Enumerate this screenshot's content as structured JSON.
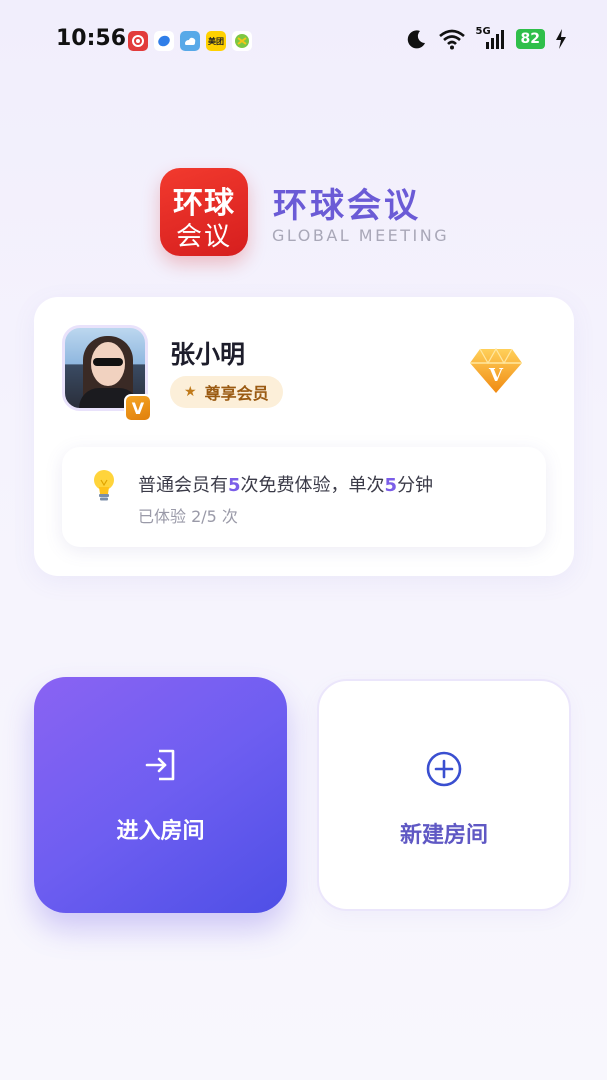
{
  "status_bar": {
    "time": "10:56",
    "network": "5G",
    "battery": "82",
    "apps": [
      {
        "name": "app-icon-1",
        "color": "#e23b3b",
        "text": ""
      },
      {
        "name": "app-icon-2",
        "color": "#2f7ee8",
        "text": ""
      },
      {
        "name": "app-icon-3",
        "color": "#58a9e8",
        "text": ""
      },
      {
        "name": "meituan-icon",
        "color": "#ffd100",
        "text": "美团"
      },
      {
        "name": "app-icon-5",
        "color": "#7cc743",
        "text": ""
      }
    ]
  },
  "brand": {
    "logo_line1": "环球",
    "logo_line2": "会议",
    "name": "环球会议",
    "subtitle": "GLOBAL MEETING",
    "logo_color": "#e5271f",
    "name_color": "#6b5bd6"
  },
  "profile": {
    "name": "张小明",
    "avatar_badge": "V",
    "member_level": "尊享会员",
    "diamond_letter": "V"
  },
  "tip": {
    "parts": [
      "普通会员有",
      "5",
      "次免费体验，单次",
      "5",
      "分钟"
    ],
    "usage": "已体验 2/5 次",
    "highlight_color": "#7b5ee8"
  },
  "actions": {
    "enter_room": "进入房间",
    "create_room": "新建房间",
    "accent": "#6e5ef1"
  }
}
